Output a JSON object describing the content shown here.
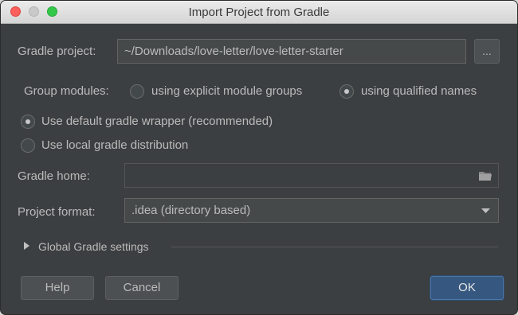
{
  "window": {
    "title": "Import Project from Gradle"
  },
  "form": {
    "gradle_project_label": "Gradle project:",
    "gradle_project_value": "~/Downloads/love-letter/love-letter-starter",
    "browse_label": "...",
    "group_modules_label": "Group modules:",
    "group_modules_options": [
      {
        "label": "using explicit module groups",
        "selected": false
      },
      {
        "label": "using qualified names",
        "selected": true
      }
    ],
    "wrapper_options": [
      {
        "label": "Use default gradle wrapper (recommended)",
        "selected": true
      },
      {
        "label": "Use local gradle distribution",
        "selected": false
      }
    ],
    "gradle_home_label": "Gradle home:",
    "gradle_home_value": "",
    "project_format_label": "Project format:",
    "project_format_value": ".idea (directory based)",
    "global_settings_label": "Global Gradle settings"
  },
  "buttons": {
    "help": "Help",
    "cancel": "Cancel",
    "ok": "OK"
  },
  "icons": {
    "folder": "folder-icon",
    "dropdown": "chevron-down-icon",
    "disclosure": "disclosure-triangle-icon"
  },
  "colors": {
    "background": "#3c3f41",
    "primary_button": "#365880",
    "text": "#bbbbbb"
  }
}
